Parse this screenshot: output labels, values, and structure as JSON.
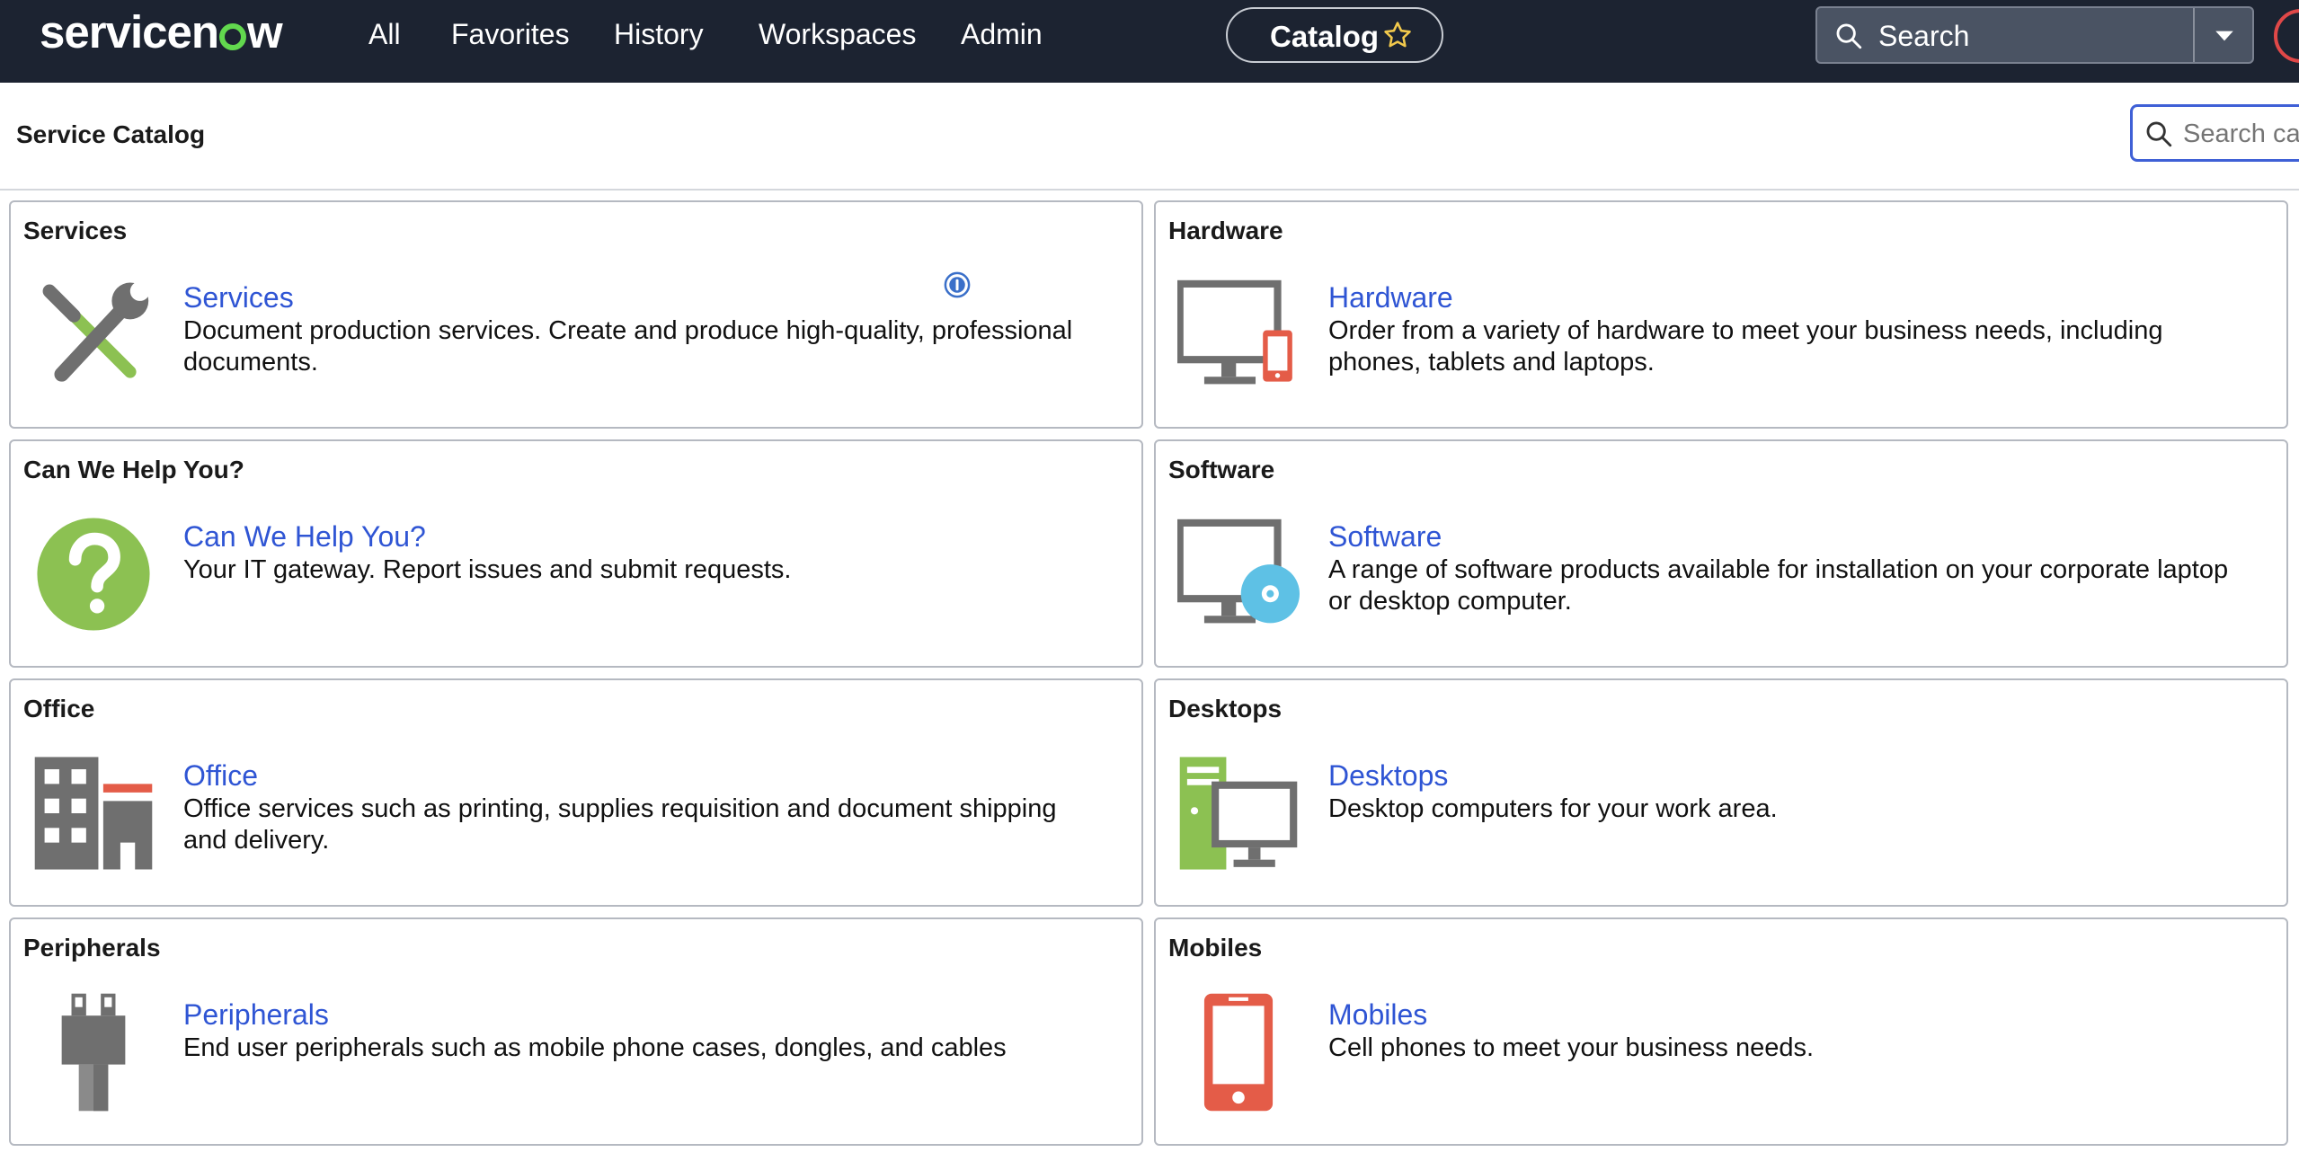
{
  "app": {
    "brand": "servicenow",
    "nav": [
      "All",
      "Favorites",
      "History",
      "Workspaces",
      "Admin"
    ],
    "catalog_label": "Catalog",
    "search_label": "Search"
  },
  "page": {
    "title": "Service Catalog",
    "search_placeholder": "Search catalog"
  },
  "categories": [
    {
      "header": "Services",
      "link": "Services",
      "description": "Document production services. Create and produce high-quality, professional documents.",
      "icon": "tools-icon"
    },
    {
      "header": "Hardware",
      "link": "Hardware",
      "description": "Order from a variety of hardware to meet your business needs, including phones, tablets and laptops.",
      "icon": "hardware-icon"
    },
    {
      "header": "Can We Help You?",
      "link": "Can We Help You?",
      "description": "Your IT gateway. Report issues and submit requests.",
      "icon": "help-icon"
    },
    {
      "header": "Software",
      "link": "Software",
      "description": "A range of software products available for installation on your corporate laptop or desktop computer.",
      "icon": "software-icon"
    },
    {
      "header": "Office",
      "link": "Office",
      "description": "Office services such as printing, supplies requisition and document shipping and delivery.",
      "icon": "office-building-icon"
    },
    {
      "header": "Desktops",
      "link": "Desktops",
      "description": "Desktop computers for your work area.",
      "icon": "desktop-icon"
    },
    {
      "header": "Peripherals",
      "link": "Peripherals",
      "description": "End user peripherals such as mobile phone cases, dongles, and cables",
      "icon": "plug-icon"
    },
    {
      "header": "Mobiles",
      "link": "Mobiles",
      "description": "Cell phones to meet your business needs.",
      "icon": "mobile-phone-icon"
    }
  ],
  "colors": {
    "topbar": "#1c2331",
    "link": "#2f55d4",
    "brand_green": "#62d84e",
    "icon_gray": "#6f6f6f",
    "icon_green": "#8cc152",
    "icon_red": "#e45c48",
    "icon_blue": "#5ec1e5"
  }
}
